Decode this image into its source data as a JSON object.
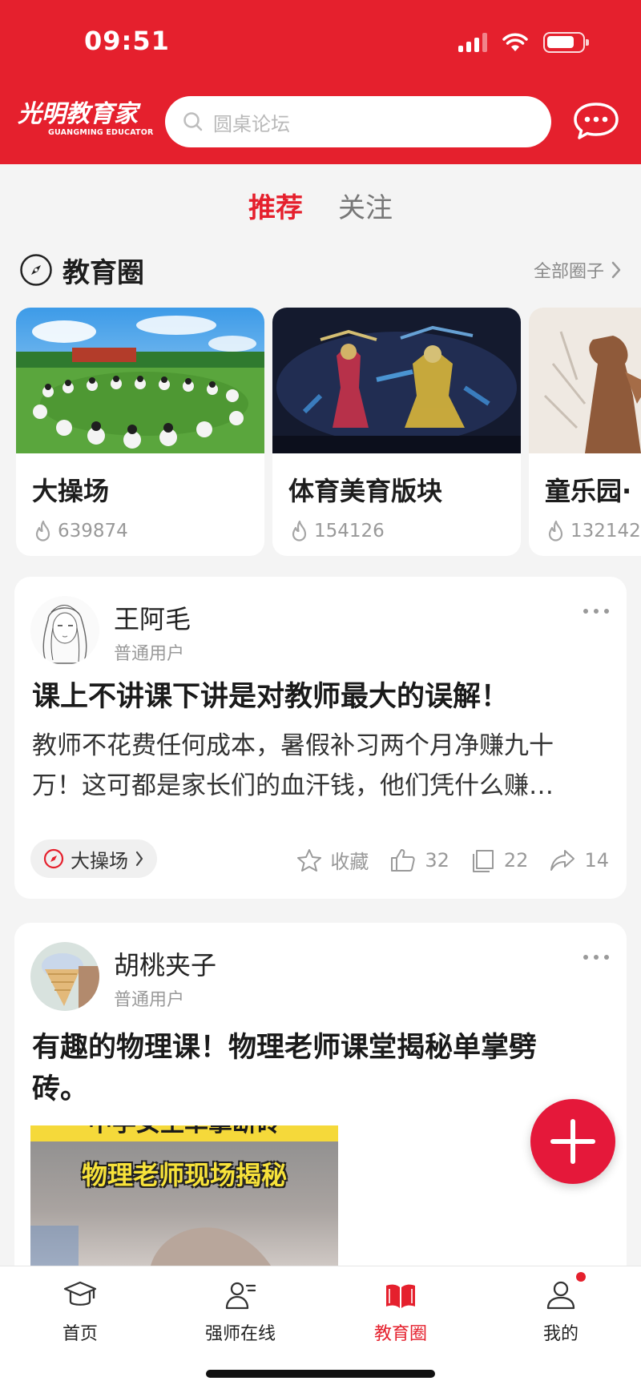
{
  "status_bar": {
    "time": "09:51"
  },
  "header": {
    "logo_cn": "光明教育家",
    "logo_en": "GUANGMING EDUCATOR",
    "search_placeholder": "圆桌论坛"
  },
  "tabs": [
    {
      "label": "推荐",
      "active": true
    },
    {
      "label": "关注",
      "active": false
    }
  ],
  "circle_section": {
    "title": "教育圈",
    "all_link": "全部圈子",
    "cards": [
      {
        "name": "大操场",
        "heat": "639874"
      },
      {
        "name": "体育美育版块",
        "heat": "154126"
      },
      {
        "name": "童乐园·",
        "heat": "132142"
      }
    ]
  },
  "posts": [
    {
      "author": "王阿毛",
      "role": "普通用户",
      "title": "课上不讲课下讲是对教师最大的误解！",
      "body_line1": "教师不花费任何成本，暑假补习两个月净赚九十",
      "body_line2": "万！这可都是家长们的血汗钱，他们凭什么赚…",
      "tag": "大操场",
      "favorite_label": "收藏",
      "likes": "32",
      "comments": "22",
      "shares": "14"
    },
    {
      "author": "胡桃夹子",
      "role": "普通用户",
      "title_line1": "有趣的物理课！物理老师课堂揭秘单掌劈",
      "title_line2": "砖。",
      "video_caption1": "中学女生单掌断砖",
      "video_caption2": "物理老师现场揭秘"
    }
  ],
  "bottom_nav": [
    {
      "label": "首页",
      "icon": "graduation-cap-icon",
      "active": false
    },
    {
      "label": "强师在线",
      "icon": "teacher-icon",
      "active": false
    },
    {
      "label": "教育圈",
      "icon": "open-book-icon",
      "active": true
    },
    {
      "label": "我的",
      "icon": "user-icon",
      "active": false
    }
  ],
  "colors": {
    "brand_red": "#e5202d",
    "fab_red": "#e5183a"
  }
}
